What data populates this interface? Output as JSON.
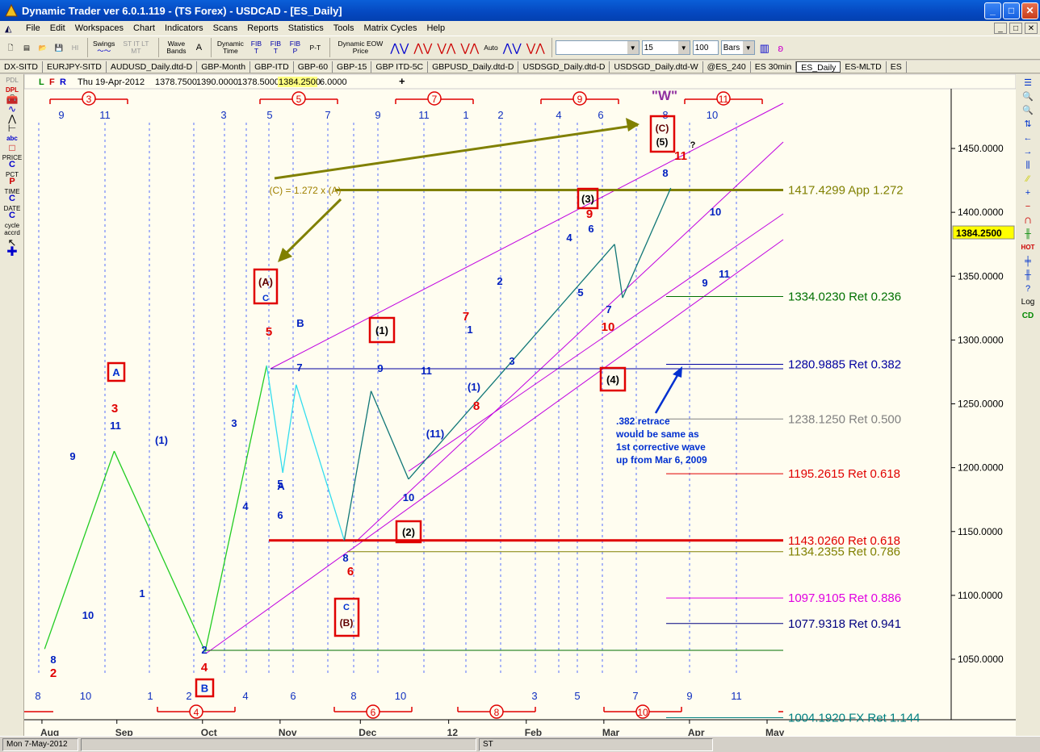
{
  "window": {
    "title": "Dynamic Trader ver 6.0.1.119 - (TS Forex) - USDCAD - [ES_Daily]",
    "buttons": {
      "minimize": "_",
      "maximize": "□",
      "close": "✕"
    }
  },
  "menu": [
    "File",
    "Edit",
    "Workspaces",
    "Chart",
    "Indicators",
    "Scans",
    "Reports",
    "Statistics",
    "Tools",
    "Matrix Cycles",
    "Help"
  ],
  "mdi_buttons": [
    "_",
    "□",
    "✕"
  ],
  "toolbar": {
    "swings_label": "Swings",
    "st_labels": "ST IT LT MT",
    "hi_label": "HI",
    "wave_bands": "Wave Bands",
    "a_label": "A",
    "dynamic_time": "Dynamic Time",
    "fib_t": "FIB T",
    "fib_t2": "FIB T",
    "fib_p": "FIB P",
    "p_t": "P-T",
    "dynamic_eow": "Dynamic EOW Price",
    "auto": "Auto",
    "interval_value": "15",
    "bars_count": "100",
    "bars_unit": "Bars"
  },
  "tabs": [
    "DX-SITD",
    "EURJPY-SITD",
    "AUDUSD_Daily.dtd-D",
    "GBP-Month",
    "GBP-ITD",
    "GBP-60",
    "GBP-15",
    "GBP ITD-5C",
    "GBPUSD_Daily.dtd-D",
    "USDSGD_Daily.dtd-D",
    "USDSGD_Daily.dtd-W",
    "@ES_240",
    "ES 30min",
    "ES_Daily",
    "ES-MLTD",
    "ES"
  ],
  "active_tab": "ES_Daily",
  "left_tools": [
    "PDL",
    "DPL",
    "abc",
    "PRICE",
    "C",
    "PCT",
    "P",
    "TIME",
    "C",
    "DATE",
    "C",
    "cycle accrd"
  ],
  "right_tools": [
    "HOT",
    "Log",
    "CD"
  ],
  "header": {
    "ohlc_letters": [
      "L",
      "F",
      "R"
    ],
    "date": "Thu 19-Apr-2012",
    "open": "1378.7500",
    "high": "1390.0000",
    "low": "1378.5000",
    "close": "1384.2500",
    "change": "6.0000"
  },
  "status": {
    "date": "Mon 7-May-2012",
    "st": "ST"
  },
  "chart_data": {
    "type": "line",
    "y_ticks": [
      "1450.0000",
      "1400.0000",
      "1350.0000",
      "1300.0000",
      "1250.0000",
      "1200.0000",
      "1150.0000",
      "1100.0000",
      "1050.0000"
    ],
    "last_price": "1384.2500",
    "x_months": [
      "Aug",
      "Sep",
      "Oct",
      "Nov",
      "Dec",
      "12",
      "Feb",
      "Mar",
      "Apr",
      "May"
    ],
    "fib_levels": [
      {
        "label": "1417.4299 App 1.272",
        "price": 1417.43,
        "color": "#808000"
      },
      {
        "label": "1334.0230 Ret 0.236",
        "price": 1334.02,
        "color": "#007000"
      },
      {
        "label": "1280.9885 Ret 0.382",
        "price": 1280.99,
        "color": "#0000a0"
      },
      {
        "label": "1238.1250 Ret 0.500",
        "price": 1238.13,
        "color": "#808080"
      },
      {
        "label": "1195.2615 Ret 0.618",
        "price": 1195.26,
        "color": "#e00000"
      },
      {
        "label": "1143.0260 Ret 0.618",
        "price": 1143.03,
        "color": "#e00000"
      },
      {
        "label": "1134.2355 Ret 0.786",
        "price": 1134.24,
        "color": "#808000"
      },
      {
        "label": "1097.9105 Ret 0.886",
        "price": 1097.91,
        "color": "#e000e0"
      },
      {
        "label": "1077.9318 Ret 0.941",
        "price": 1077.93,
        "color": "#000080"
      },
      {
        "label": "1004.1920 FX Ret 1.144",
        "price": 1004.19,
        "color": "#008080"
      }
    ],
    "swing_points": [
      {
        "date": "2011-08-05",
        "price": 1058
      },
      {
        "date": "2011-08-31",
        "price": 1213
      },
      {
        "date": "2011-10-04",
        "price": 1056
      },
      {
        "date": "2011-10-27",
        "price": 1280
      },
      {
        "date": "2011-11-02",
        "price": 1196
      },
      {
        "date": "2011-11-07",
        "price": 1265
      },
      {
        "date": "2011-11-25",
        "price": 1143
      },
      {
        "date": "2011-12-05",
        "price": 1260
      },
      {
        "date": "2011-12-19",
        "price": 1191
      },
      {
        "date": "2012-03-05",
        "price": 1375
      },
      {
        "date": "2012-03-08",
        "price": 1333
      },
      {
        "date": "2012-03-26",
        "price": 1419
      }
    ],
    "annotations": {
      "w_label": "\"W\"",
      "c_eq": "(C) = 1.272 x (A)",
      "retrace_note": [
        ".382 retrace",
        "would be same as",
        "1st corrective wave",
        "up from Mar 6, 2009"
      ],
      "question": "?",
      "boxed": [
        "A",
        "(A)",
        "C",
        "(1)",
        "(2)",
        "(3)",
        "(4)",
        "(C)",
        "(5)",
        "C",
        "(B)",
        "B"
      ],
      "circled_top": [
        "3",
        "5",
        "7",
        "9",
        "11"
      ],
      "circled_bottom": [
        "4",
        "6",
        "8",
        "10"
      ],
      "top_cycle_nums": [
        "9",
        "11",
        "3",
        "5",
        "7",
        "9",
        "11",
        "1",
        "2",
        "4",
        "6",
        "8",
        "10"
      ],
      "bottom_cycle_nums": [
        "8",
        "10",
        "1",
        "2",
        "4",
        "6",
        "8",
        "10",
        "3",
        "5",
        "7",
        "9",
        "11"
      ],
      "wave_labels_blue": [
        "8",
        "10",
        "1",
        "9",
        "(1)",
        "11",
        "2",
        "3",
        "4",
        "5",
        "7",
        "6",
        "A",
        "B",
        "9",
        "11",
        "8",
        "10",
        "(11)",
        "(1)",
        "3",
        "1",
        "2",
        "4",
        "6",
        "5",
        "7",
        "8",
        "10",
        "9",
        "11"
      ],
      "wave_labels_red": [
        "2",
        "3",
        "4",
        "5",
        "6",
        "8",
        "7",
        "9",
        "10",
        "11"
      ]
    }
  }
}
